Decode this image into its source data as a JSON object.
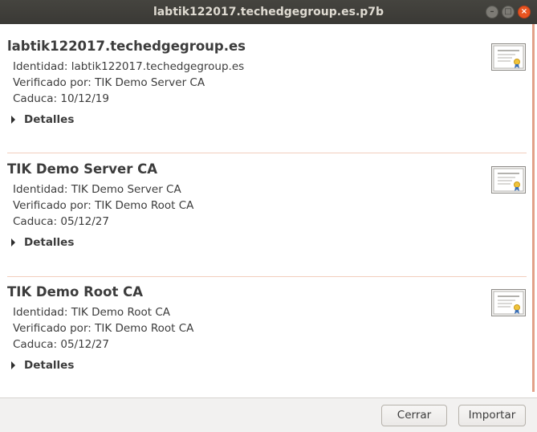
{
  "window": {
    "title": "labtik122017.techedgegroup.es.p7b"
  },
  "certificates": [
    {
      "title": "labtik122017.techedgegroup.es",
      "identity": "Identidad: labtik122017.techedgegroup.es",
      "verified_by": "Verificado por: TIK Demo Server CA",
      "expires": "Caduca: 10/12/19",
      "details_label": "Detalles"
    },
    {
      "title": "TIK Demo Server CA",
      "identity": "Identidad: TIK Demo Server CA",
      "verified_by": "Verificado por: TIK Demo Root CA",
      "expires": "Caduca: 05/12/27",
      "details_label": "Detalles"
    },
    {
      "title": "TIK Demo Root CA",
      "identity": "Identidad: TIK Demo Root CA",
      "verified_by": "Verificado por: TIK Demo Root CA",
      "expires": "Caduca: 05/12/27",
      "details_label": "Detalles"
    }
  ],
  "buttons": {
    "close_label": "Cerrar",
    "import_label": "Importar"
  },
  "colors": {
    "titlebar": "#3c3b37",
    "accent": "#e95420",
    "separator": "#f2cdbd",
    "text": "#3c3c3c"
  }
}
